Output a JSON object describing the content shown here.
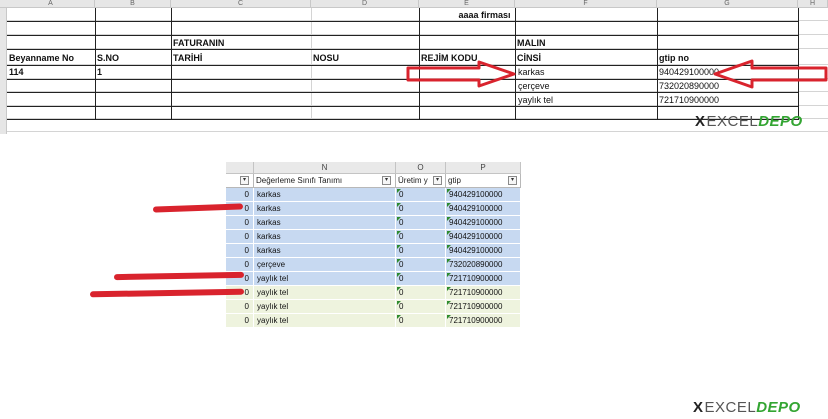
{
  "top_sheet": {
    "col_letters": [
      "A",
      "B",
      "C",
      "D",
      "E",
      "F",
      "G",
      "H"
    ],
    "title": "aaaa firması",
    "group_headers": {
      "faturanin": "FATURANIN",
      "malin": "MALIN"
    },
    "headers": {
      "beyanname_no": "Beyanname No",
      "s_no": "S.NO",
      "tarihi": "TARİHİ",
      "nosu": "NOSU",
      "rejim_kodu": "REJİM KODU",
      "cinsi": "CİNSİ",
      "gtip_no": "gtip no"
    },
    "rows": [
      {
        "beyanname_no": "114",
        "s_no": "1",
        "cinsi": "karkas",
        "gtip": "940429100000"
      },
      {
        "beyanname_no": "",
        "s_no": "",
        "cinsi": "çerçeve",
        "gtip": "732020890000"
      },
      {
        "beyanname_no": "",
        "s_no": "",
        "cinsi": "yaylık tel",
        "gtip": "721710900000"
      }
    ]
  },
  "logo": {
    "x": "X",
    "excel": "EXCEL",
    "depo": "DEPO"
  },
  "snippet": {
    "col_letters": {
      "n": "N",
      "o": "O",
      "p": "P"
    },
    "headers": {
      "degerleme": "Değerleme Sınıfı Tanımı",
      "uretim": "Üretim y",
      "gtip": "gtip"
    },
    "filter_glyph": "▾",
    "rows": [
      {
        "zero": "0",
        "name": "karkas",
        "o": "0",
        "gtip": "940429100000",
        "tint": "blue"
      },
      {
        "zero": "0",
        "name": "karkas",
        "o": "0",
        "gtip": "940429100000",
        "tint": "blue"
      },
      {
        "zero": "0",
        "name": "karkas",
        "o": "0",
        "gtip": "940429100000",
        "tint": "blue"
      },
      {
        "zero": "0",
        "name": "karkas",
        "o": "0",
        "gtip": "940429100000",
        "tint": "blue"
      },
      {
        "zero": "0",
        "name": "karkas",
        "o": "0",
        "gtip": "940429100000",
        "tint": "blue"
      },
      {
        "zero": "0",
        "name": "çerçeve",
        "o": "0",
        "gtip": "732020890000",
        "tint": "blue"
      },
      {
        "zero": "0",
        "name": "yaylık tel",
        "o": "0",
        "gtip": "721710900000",
        "tint": "blue"
      },
      {
        "zero": "0",
        "name": "yaylık tel",
        "o": "0",
        "gtip": "721710900000",
        "tint": "green"
      },
      {
        "zero": "0",
        "name": "yaylık tel",
        "o": "0",
        "gtip": "721710900000",
        "tint": "green"
      },
      {
        "zero": "0",
        "name": "yaylık tel",
        "o": "0",
        "gtip": "721710900000",
        "tint": "green"
      }
    ]
  },
  "colors": {
    "arrow_red": "#d9232d",
    "marker_red": "#d9232d",
    "depo_green": "#33a532",
    "filtered_blue": "#c7d9f1",
    "filtered_green": "#eef3de"
  }
}
